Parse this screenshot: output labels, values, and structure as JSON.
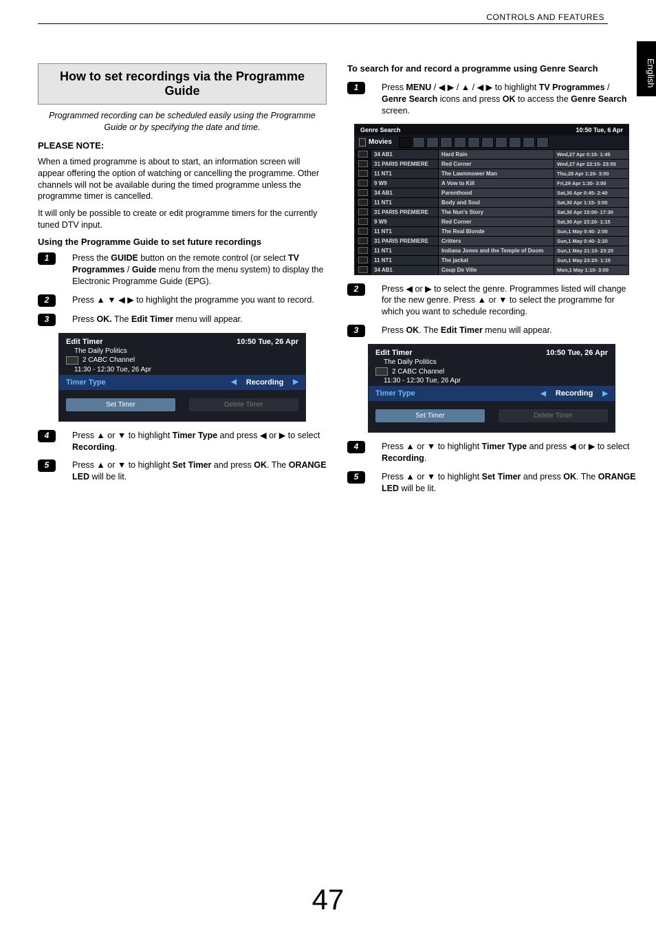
{
  "header": {
    "section": "CONTROLS AND FEATURES"
  },
  "sidebar": {
    "lang": "English"
  },
  "page_number": "47",
  "left": {
    "title": "How to set recordings via the Programme Guide",
    "intro": "Programmed recording can be scheduled easily using the Programme Guide or by specifying the date and time.",
    "please_note_label": "PLEASE NOTE:",
    "please_note_p1": "When a timed programme is about to start, an information screen will appear offering the option of watching or cancelling the programme. Other channels will not be available during the timed programme unless the programme timer is cancelled.",
    "please_note_p2": "It will only be possible to create or edit programme timers for the currently tuned DTV input.",
    "using_title": "Using the Programme Guide to set future recordings",
    "steps": {
      "s1a": "Press the ",
      "s1b": "GUIDE",
      "s1c": " button on the remote control (or select ",
      "s1d": "TV Programmes",
      "s1e": " / ",
      "s1f": "Guide",
      "s1g": " menu from the menu system) to display the Electronic Programme Guide (EPG).",
      "s2a": "Press ▲ ▼ ◀ ▶ to highlight the programme you want to record.",
      "s3a": "Press ",
      "s3b": "OK.",
      "s3c": " The ",
      "s3d": "Edit Timer",
      "s3e": " menu will appear.",
      "s4a": "Press ▲ or ▼ to highlight ",
      "s4b": "Timer Type",
      "s4c": " and press ◀ or ▶ to select ",
      "s4d": "Recording",
      "s4e": ".",
      "s5a": "Press ▲ or ▼ to highlight ",
      "s5b": "Set Timer",
      "s5c": " and press ",
      "s5d": "OK",
      "s5e": ". The ",
      "s5f": "ORANGE LED",
      "s5g": " will be lit."
    }
  },
  "edit_timer": {
    "title": "Edit Timer",
    "clock": "10:50 Tue, 26 Apr",
    "prog": "The Daily Politics",
    "channel": "2 CABC Channel",
    "time": "11:30 - 12:30 Tue, 26 Apr",
    "timer_type_label": "Timer Type",
    "timer_type_value": "Recording",
    "set_btn": "Set Timer",
    "del_btn": "Delete Timer"
  },
  "right": {
    "title": "To search for and record a programme using Genre Search",
    "s1a": "Press ",
    "s1b": "MENU",
    "s1c": " / ◀ ▶ / ▲ / ◀ ▶ to highlight ",
    "s1d": "TV Programmes",
    "s1e": " / ",
    "s1f": "Genre Search",
    "s1g": " icons and press ",
    "s1h": "OK",
    "s1i": " to access the ",
    "s1j": "Genre Search",
    "s1k": " screen.",
    "s2a": "Press ◀ or ▶ to select the genre. Programmes listed will change for the new genre. Press ▲ or ▼ to select the programme for which you want to schedule recording.",
    "s3a": "Press ",
    "s3b": "OK",
    "s3c": ". The ",
    "s3d": "Edit Timer",
    "s3e": " menu will appear.",
    "s4a": "Press ▲ or ▼ to highlight ",
    "s4b": "Timer Type",
    "s4c": " and press ◀ or ▶ to select ",
    "s4d": "Recording",
    "s4e": ".",
    "s5a": "Press ▲ or ▼ to highlight ",
    "s5b": "Set Timer",
    "s5c": " and press ",
    "s5d": "OK",
    "s5e": ". The ",
    "s5f": "ORANGE LED",
    "s5g": " will be lit."
  },
  "genre": {
    "title": "Genre Search",
    "clock": "10:50 Tue, 6 Apr",
    "category": "Movies",
    "rows": [
      {
        "ch": "34 AB1",
        "prog": "Hard Rain",
        "time": "Wed,27 Apr  0:15- 1:45"
      },
      {
        "ch": "31 PARIS PREMIERE",
        "prog": "Red Corner",
        "time": "Wed,27 Apr 22:15- 23:55"
      },
      {
        "ch": "11 NT1",
        "prog": "The Lawnmower Man",
        "time": "Thu,28 Apr  1:20- 3:00"
      },
      {
        "ch": "9    W9",
        "prog": "A Vow to Kill",
        "time": "Fri,29 Apr  1:30- 3:00"
      },
      {
        "ch": "34 AB1",
        "prog": "Parenthood",
        "time": "Sat,30 Apr  0:45- 2:40"
      },
      {
        "ch": "11 NT1",
        "prog": "Body and Soul",
        "time": "Sat,30 Apr  1:15- 3:00"
      },
      {
        "ch": "31 PARIS PREMIERE",
        "prog": "The Nun's Story",
        "time": "Sat,30 Apr 15:00- 17:30"
      },
      {
        "ch": "9    W9",
        "prog": "Red Corner",
        "time": "Sat,30 Apr 23:20- 1:15"
      },
      {
        "ch": "11 NT1",
        "prog": "The Real Blonde",
        "time": "Sun,1 May  0:40- 2:00"
      },
      {
        "ch": "31 PARIS PREMIERE",
        "prog": "Critters",
        "time": "Sun,1 May  0:40- 2:20"
      },
      {
        "ch": "11 NT1",
        "prog": "Indiana Jones and the Temple of Doom",
        "time": "Sun,1 May 21:10- 23:20"
      },
      {
        "ch": "11 NT1",
        "prog": "The jackal",
        "time": "Sun,1 May 23:20- 1:15"
      },
      {
        "ch": "34 AB1",
        "prog": "Coup De Ville",
        "time": "Mon,1 May  1:10- 3:00"
      }
    ]
  }
}
